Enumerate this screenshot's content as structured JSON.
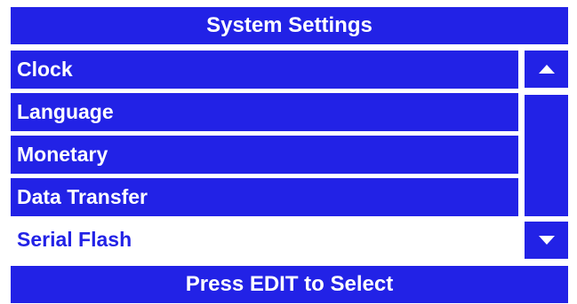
{
  "header": {
    "title": "System Settings"
  },
  "menu": {
    "items": [
      {
        "label": "Clock"
      },
      {
        "label": "Language"
      },
      {
        "label": "Monetary"
      },
      {
        "label": "Data Transfer"
      },
      {
        "label": "Serial Flash",
        "selected": true
      }
    ]
  },
  "scroll": {
    "up_icon": "triangle-up-icon",
    "down_icon": "triangle-down-icon"
  },
  "footer": {
    "prompt": "Press EDIT to Select"
  },
  "colors": {
    "accent": "#2222e6",
    "text": "#ffffff",
    "selected_bg": "#ffffff"
  }
}
